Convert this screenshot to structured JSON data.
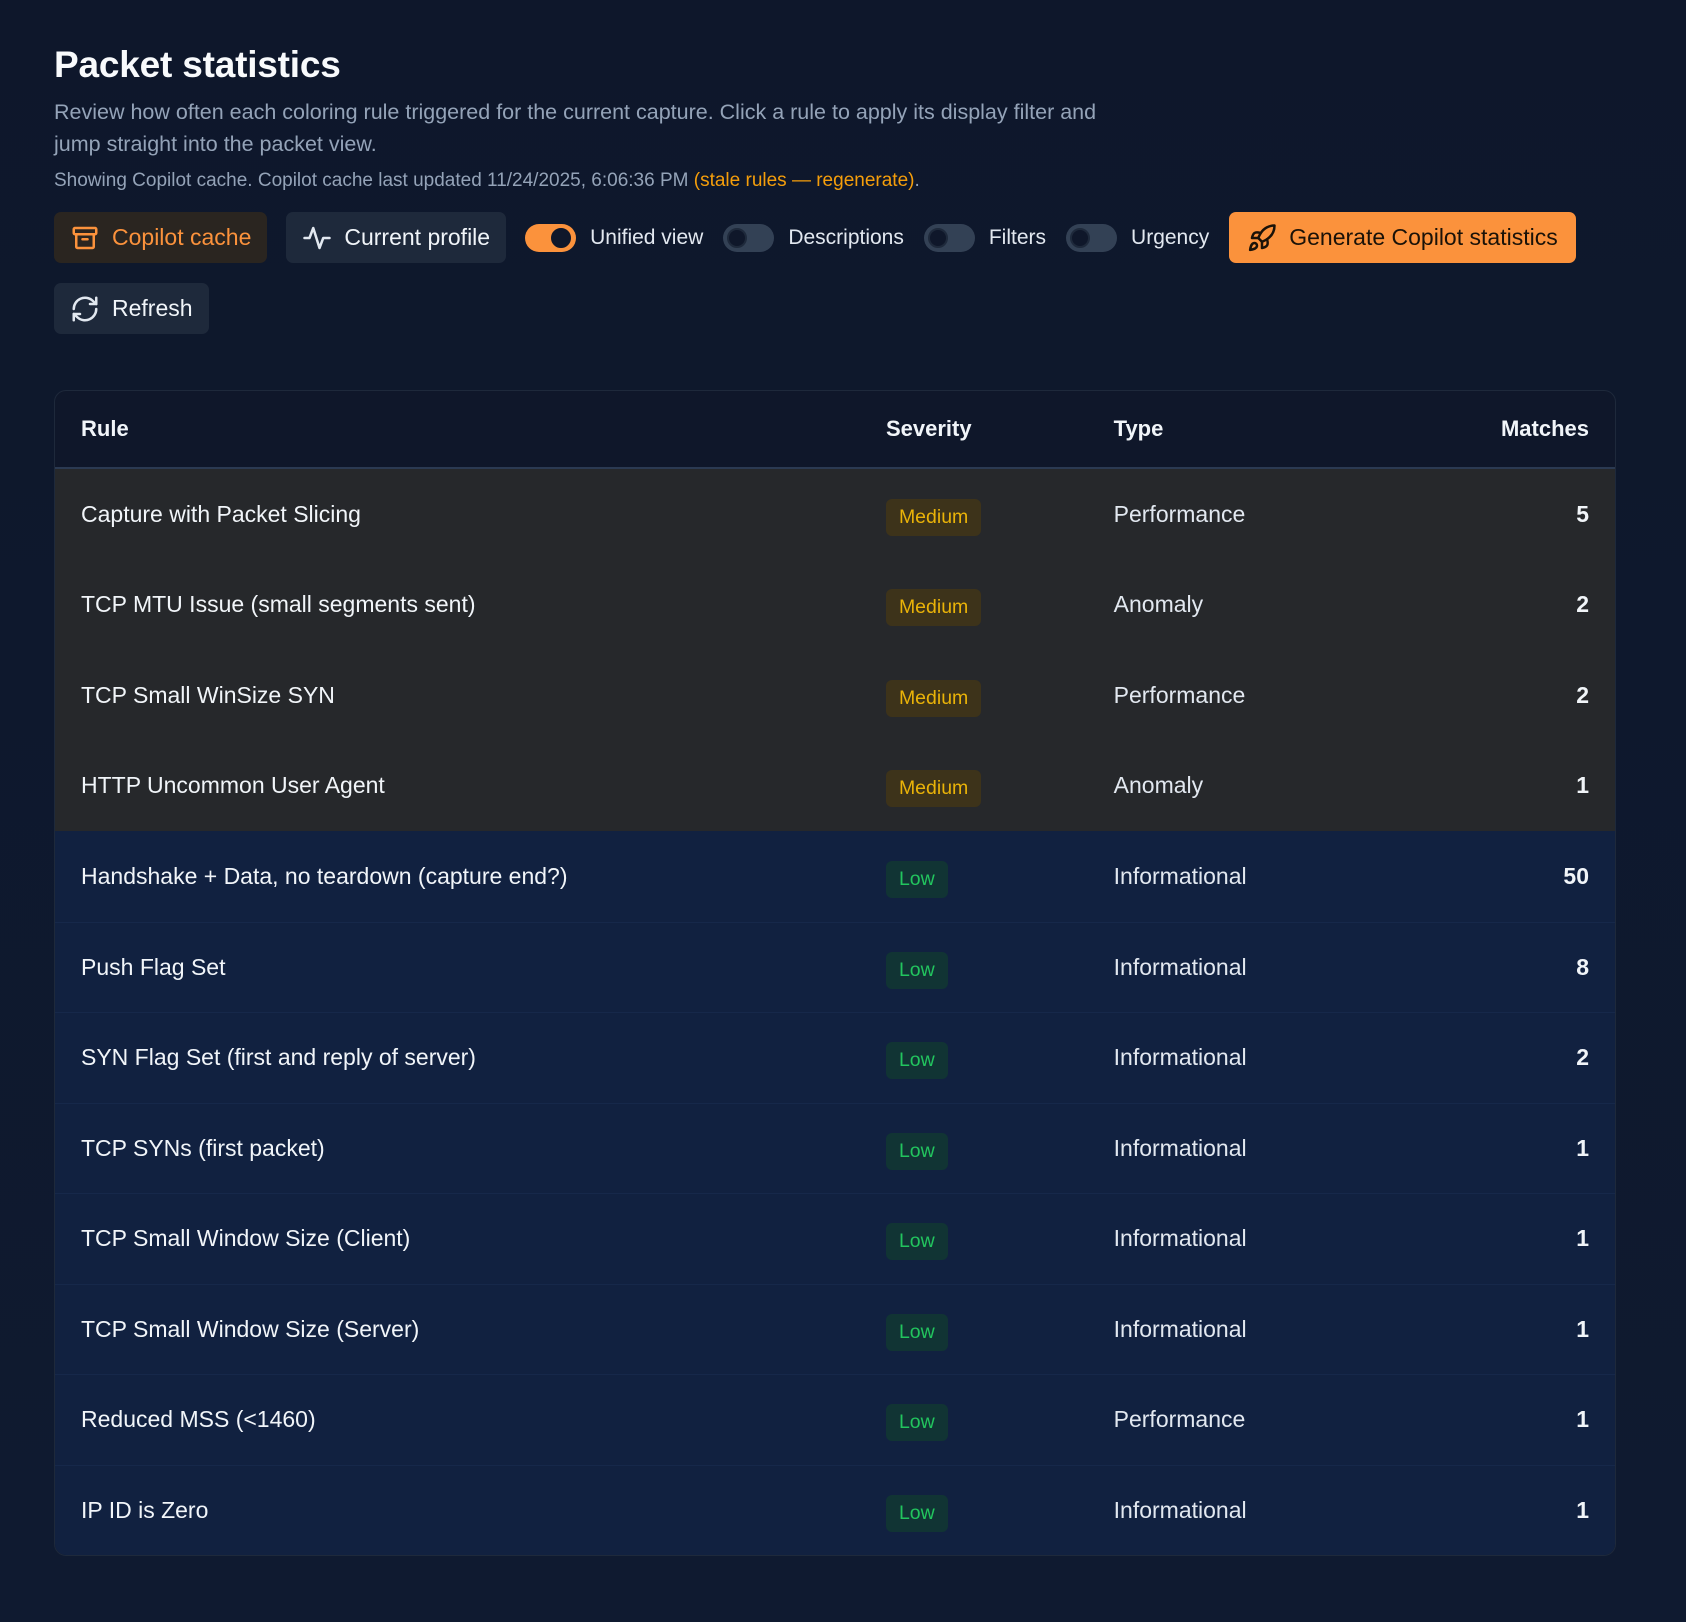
{
  "header": {
    "title": "Packet statistics",
    "description": "Review how often each coloring rule triggered for the current capture. Click a rule to apply its display filter and jump straight into the packet view.",
    "meta_prefix": "Showing Copilot cache. Copilot cache last updated 11/24/2025, 6:06:36 PM",
    "meta_stale": "(stale rules — regenerate)",
    "meta_suffix": "."
  },
  "toolbar": {
    "copilot_cache_label": "Copilot cache",
    "current_profile_label": "Current profile",
    "toggles": [
      {
        "label": "Unified view",
        "on": true
      },
      {
        "label": "Descriptions",
        "on": false
      },
      {
        "label": "Filters",
        "on": false
      },
      {
        "label": "Urgency",
        "on": false
      }
    ],
    "generate_label": "Generate Copilot statistics",
    "refresh_label": "Refresh"
  },
  "table": {
    "headers": {
      "rule": "Rule",
      "severity": "Severity",
      "type": "Type",
      "matches": "Matches"
    },
    "rows": [
      {
        "rule": "Capture with Packet Slicing",
        "severity": "Medium",
        "type": "Performance",
        "matches": "5"
      },
      {
        "rule": "TCP MTU Issue (small segments sent)",
        "severity": "Medium",
        "type": "Anomaly",
        "matches": "2"
      },
      {
        "rule": "TCP Small WinSize SYN",
        "severity": "Medium",
        "type": "Performance",
        "matches": "2"
      },
      {
        "rule": "HTTP Uncommon User Agent",
        "severity": "Medium",
        "type": "Anomaly",
        "matches": "1"
      },
      {
        "rule": "Handshake + Data, no teardown (capture end?)",
        "severity": "Low",
        "type": "Informational",
        "matches": "50"
      },
      {
        "rule": "Push Flag Set",
        "severity": "Low",
        "type": "Informational",
        "matches": "8"
      },
      {
        "rule": "SYN Flag Set (first and reply of server)",
        "severity": "Low",
        "type": "Informational",
        "matches": "2"
      },
      {
        "rule": "TCP SYNs (first packet)",
        "severity": "Low",
        "type": "Informational",
        "matches": "1"
      },
      {
        "rule": "TCP Small Window Size (Client)",
        "severity": "Low",
        "type": "Informational",
        "matches": "1"
      },
      {
        "rule": "TCP Small Window Size (Server)",
        "severity": "Low",
        "type": "Informational",
        "matches": "1"
      },
      {
        "rule": "Reduced MSS (<1460)",
        "severity": "Low",
        "type": "Performance",
        "matches": "1"
      },
      {
        "rule": "IP ID is Zero",
        "severity": "Low",
        "type": "Informational",
        "matches": "1"
      }
    ]
  },
  "colors": {
    "accent": "#fb923c",
    "medium_badge": "#eab308",
    "low_badge": "#22c55e",
    "stale_text": "#f59e0b"
  }
}
